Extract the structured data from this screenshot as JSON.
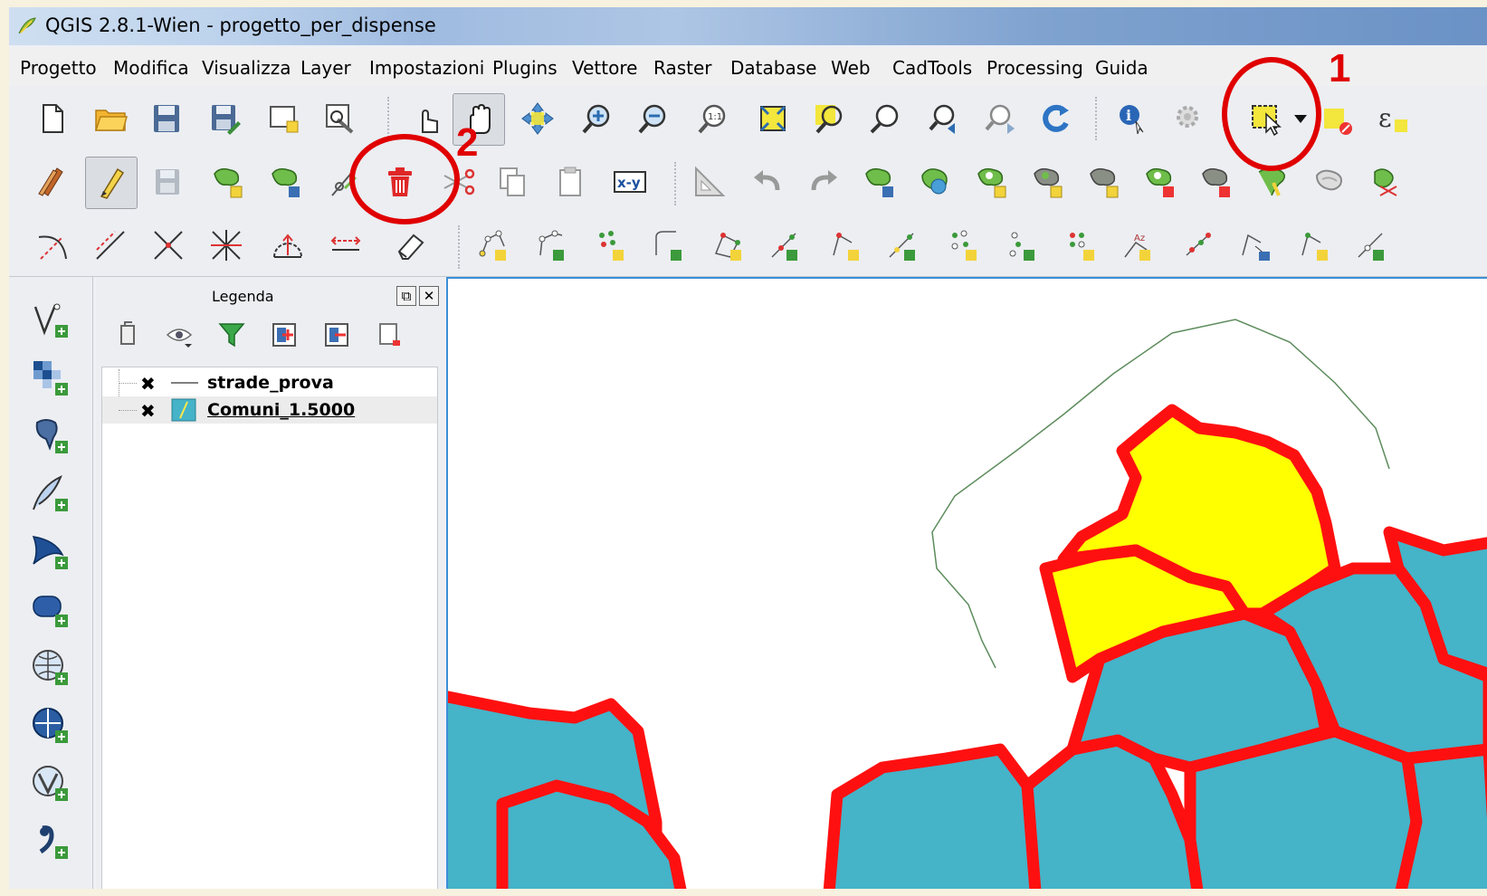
{
  "window": {
    "title": "QGIS 2.8.1-Wien - progetto_per_dispense"
  },
  "menu": [
    "Progetto",
    "Modifica",
    "Visualizza",
    "Layer",
    "Impostazioni",
    "Plugins",
    "Vettore",
    "Raster",
    "Database",
    "Web",
    "CadTools",
    "Processing",
    "Guida"
  ],
  "annotations": {
    "select_tool_number": "1",
    "delete_tool_number": "2",
    "color": "#e00000"
  },
  "legend": {
    "title": "Legenda",
    "layers": [
      {
        "name": "strade_prova",
        "visible": true,
        "type": "line"
      },
      {
        "name": "Comuni_1.5000",
        "visible": true,
        "type": "polygon",
        "selected": true
      }
    ]
  },
  "map": {
    "fill_color": "#45b3c8",
    "selected_fill": "#ffff00",
    "outline_color": "#ff0000",
    "road_color": "#5d8c5d"
  },
  "icons": {
    "toolbar1": [
      "new-project-icon",
      "open-project-icon",
      "save-project-icon",
      "save-as-icon",
      "new-print-composer-icon",
      "composer-manager-icon",
      "touch-zoom-icon",
      "pan-map-icon",
      "pan-to-selection-icon",
      "zoom-in-icon",
      "zoom-out-icon",
      "zoom-native-icon",
      "zoom-full-icon",
      "zoom-to-selection-icon",
      "zoom-to-layer-icon",
      "zoom-last-icon",
      "zoom-next-icon",
      "refresh-icon",
      "identify-icon",
      "run-feature-action-icon",
      "select-features-icon",
      "deselect-icon",
      "expression-select-icon"
    ],
    "toolbar2": [
      "current-edits-icon",
      "toggle-editing-icon",
      "save-edits-icon",
      "add-feature-icon",
      "move-feature-icon",
      "node-tool-icon",
      "delete-selected-icon",
      "cut-features-icon",
      "copy-features-icon",
      "paste-features-icon",
      "xy-tool-icon",
      "measure-tool-icon",
      "undo-icon",
      "redo-icon",
      "simplify-feature-icon",
      "add-ring-icon",
      "add-part-icon",
      "fill-ring-icon",
      "delete-ring-icon",
      "delete-part-icon",
      "reshape-icon",
      "offset-curve-icon",
      "split-features-icon",
      "merge-features-icon",
      "rotate-feature-icon"
    ],
    "toolbar3": [
      "arc-icon",
      "line-icon",
      "intersection-icon",
      "bisector-icon",
      "circle-icon",
      "parallel-icon",
      "eraser-icon"
    ]
  }
}
